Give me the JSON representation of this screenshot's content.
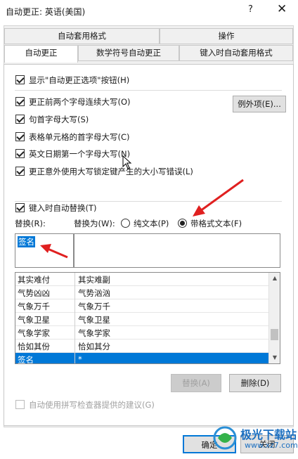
{
  "window": {
    "title": "自动更正: 英语(美国)",
    "help": "?",
    "close": "✕"
  },
  "tabs_row1": [
    {
      "label": "自动套用格式"
    },
    {
      "label": "操作"
    }
  ],
  "tabs_row2": [
    {
      "label": "自动更正",
      "active": true
    },
    {
      "label": "数学符号自动更正"
    },
    {
      "label": "键入时自动套用格式"
    }
  ],
  "options": {
    "show_buttons": {
      "label": "显示\"自动更正选项\"按钮(H)",
      "checked": true
    },
    "two_initial_caps": {
      "label": "更正前两个字母连续大写(O)",
      "checked": true
    },
    "capitalize_sentence": {
      "label": "句首字母大写(S)",
      "checked": true
    },
    "capitalize_table_cells": {
      "label": "表格单元格的首字母大写(C)",
      "checked": true
    },
    "capitalize_days": {
      "label": "英文日期第一个字母大写(N)",
      "checked": true
    },
    "caps_lock": {
      "label": "更正意外使用大写锁定键产生的大小写错误(L)",
      "checked": true
    },
    "exceptions_button": "例外项(E)..."
  },
  "replace_section": {
    "replace_as_you_type": {
      "label": "键入时自动替换(T)",
      "checked": true
    },
    "replace_label": "替换(R):",
    "with_label": "替换为(W):",
    "plain_text": {
      "label": "纯文本(P)",
      "selected": false
    },
    "formatted_text": {
      "label": "带格式文本(F)",
      "selected": true
    },
    "replace_value": "签名",
    "with_value": ""
  },
  "entries": [
    {
      "replace": "其实难付",
      "with": "其实难副",
      "selected": false
    },
    {
      "replace": "气势凶凶",
      "with": "气势汹汹",
      "selected": false
    },
    {
      "replace": "气象万千",
      "with": "气象万千",
      "selected": false
    },
    {
      "replace": "气象卫星",
      "with": "气象卫星",
      "selected": false
    },
    {
      "replace": "气象学家",
      "with": "气象学家",
      "selected": false
    },
    {
      "replace": "恰如其份",
      "with": "恰如其分",
      "selected": false
    },
    {
      "replace": "签名",
      "with": "*",
      "selected": true
    }
  ],
  "buttons": {
    "replace": "替换(A)",
    "delete": "删除(D)",
    "ok": "确定",
    "close": "关闭"
  },
  "spell_suggestions": {
    "label": "自动使用拼写检查器提供的建议(G)",
    "checked": false
  },
  "watermark": {
    "brand": "极光下载站",
    "url": "www.xz7.com"
  },
  "colors": {
    "selection": "#0078d7",
    "annotation_arrow": "#e02020"
  }
}
